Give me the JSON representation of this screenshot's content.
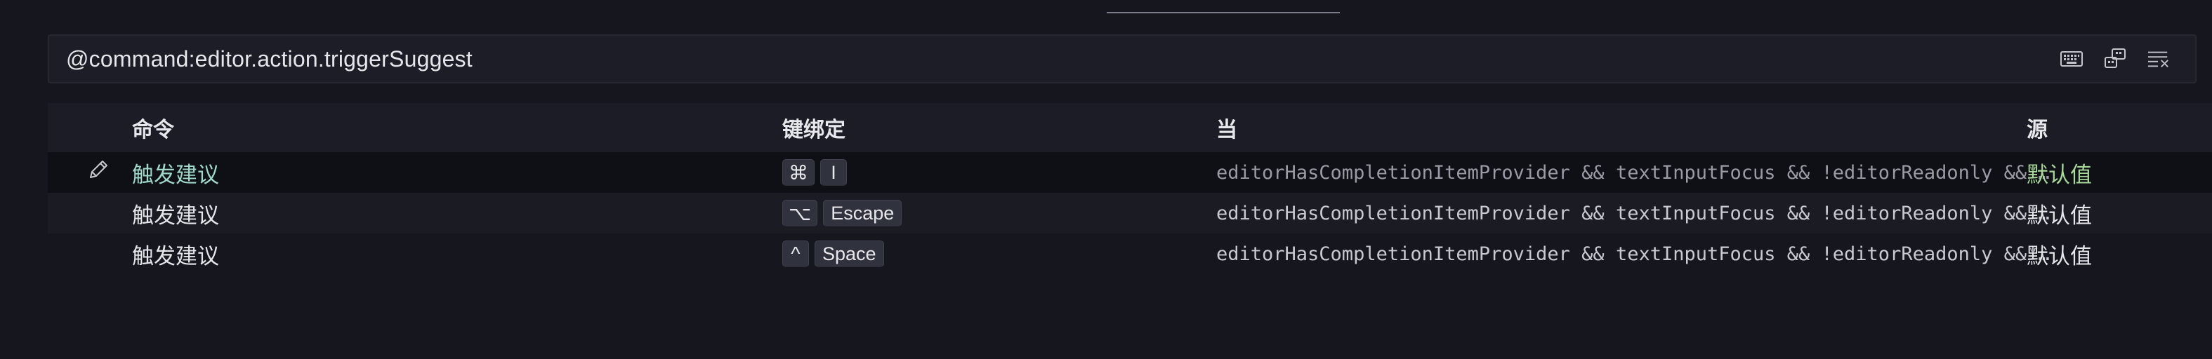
{
  "search": {
    "value": "@command:editor.action.triggerSuggest",
    "actions": [
      {
        "name": "record-keys-icon"
      },
      {
        "name": "sort-by-precedence-icon"
      },
      {
        "name": "clear-filter-icon"
      }
    ]
  },
  "table": {
    "headers": {
      "command": "命令",
      "keybinding": "键绑定",
      "when": "当",
      "source": "源"
    },
    "rows": [
      {
        "command": "触发建议",
        "keys": [
          "⌘",
          "I"
        ],
        "when": "editorHasCompletionItemProvider && textInputFocus && !editorReadonly && !suggestWidgetVisible",
        "source": "默认值",
        "selected": true
      },
      {
        "command": "触发建议",
        "keys": [
          "⌥",
          "Escape"
        ],
        "when": "editorHasCompletionItemProvider && textInputFocus && !editorReadonly && !suggestWidgetVisible",
        "source": "默认值"
      },
      {
        "command": "触发建议",
        "keys": [
          "^",
          "Space"
        ],
        "when": "editorHasCompletionItemProvider && textInputFocus && !editorReadonly && !suggestWidgetVisible",
        "source": "默认值"
      }
    ]
  },
  "colors": {
    "background": "#15161e",
    "selected_command": "#9fd8c8",
    "selected_source": "#a8d99a"
  }
}
